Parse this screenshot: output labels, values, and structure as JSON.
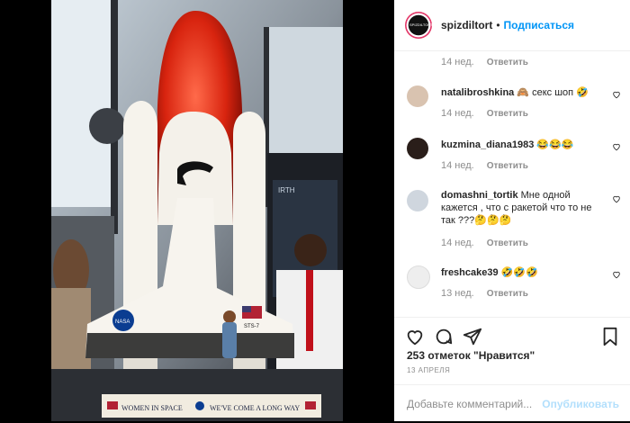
{
  "photo": {
    "banner_left": "WOMEN IN SPACE",
    "banner_right": "WE'VE COME A LONG WAY",
    "shuttle_name": "STS-7",
    "nasa_label": "NASA",
    "exhibit_text": "IRTH"
  },
  "header": {
    "avatar_text": "SPIZDILTORT",
    "username": "spizdiltort",
    "separator": "•",
    "follow": "Подписаться"
  },
  "comments": [
    {
      "username": "",
      "text": "",
      "time": "14 нед.",
      "reply": "Ответить"
    },
    {
      "username": "natalibroshkina",
      "text": "🙈 секс шоп 🤣",
      "time": "14 нед.",
      "reply": "Ответить"
    },
    {
      "username": "kuzmina_diana1983",
      "text": "😂😂😂",
      "time": "14 нед.",
      "reply": "Ответить"
    },
    {
      "username": "domashni_tortik",
      "text": "Мне одной кажется , что с ракетой что то не так ???🤔🤔🤔",
      "time": "14 нед.",
      "reply": "Ответить"
    },
    {
      "username": "freshcake39",
      "text": "🤣🤣🤣",
      "time": "13 нед.",
      "reply": "Ответить"
    }
  ],
  "actions": {
    "likes": "253 отметок \"Нравится\"",
    "date": "13 АПРЕЛЯ"
  },
  "add_comment": {
    "placeholder": "Добавьте комментарий...",
    "publish": "Опубликовать"
  }
}
